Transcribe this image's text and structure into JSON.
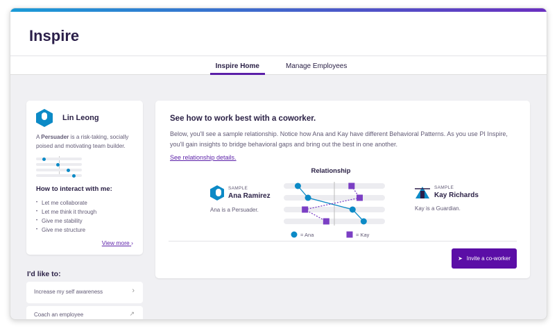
{
  "app": {
    "title": "Inspire"
  },
  "tabs": [
    {
      "label": "Inspire Home",
      "active": true
    },
    {
      "label": "Manage Employees",
      "active": false
    }
  ],
  "profile": {
    "name": "Lin Leong",
    "desc_prefix": "A ",
    "pattern": "Persuader",
    "desc_suffix": " is a risk-taking, socially poised and motivating team builder.",
    "pattern_positions": [
      17,
      48,
      71,
      82
    ],
    "interact_title": "How to interact with me:",
    "interact_items": [
      "Let me collaborate",
      "Let me think it through",
      "Give me stability",
      "Give me structure"
    ],
    "view_more": "View more"
  },
  "like": {
    "title": "I'd like to:",
    "options": [
      {
        "label": "Increase my self awareness",
        "icon": "chevron-right-icon"
      },
      {
        "label": "Coach an employee",
        "icon": "external-link-icon"
      }
    ]
  },
  "coworker": {
    "title": "See how to work best with a coworker.",
    "body": "Below, you'll see a sample relationship. Notice how Ana and Kay have different Behavioral Patterns. As you use PI Inspire, you'll gain insights to bridge behavioral gaps and bring out the best in one another.",
    "link": "See relationship details.",
    "invite": "Invite a co-worker",
    "person_a": {
      "tag": "SAMPLE",
      "name": "Ana Ramirez",
      "desc": "Ana is a Persuader."
    },
    "person_b": {
      "tag": "SAMPLE",
      "name": "Kay Richards",
      "desc": "Kay is a Guardian."
    }
  },
  "chart_data": {
    "type": "scatter",
    "title": "Relationship",
    "rows": 4,
    "xlim": [
      0,
      100
    ],
    "series": [
      {
        "name": "Ana",
        "legend": "= Ana",
        "marker": "circle",
        "color": "#0c8ac6",
        "values": [
          14,
          24,
          68,
          79
        ]
      },
      {
        "name": "Kay",
        "legend": "= Kay",
        "marker": "square",
        "color": "#7b3fc4",
        "values": [
          67,
          75,
          21,
          42
        ]
      }
    ]
  },
  "colors": {
    "accent": "#5b0ea6",
    "blue": "#0c8ac6"
  }
}
